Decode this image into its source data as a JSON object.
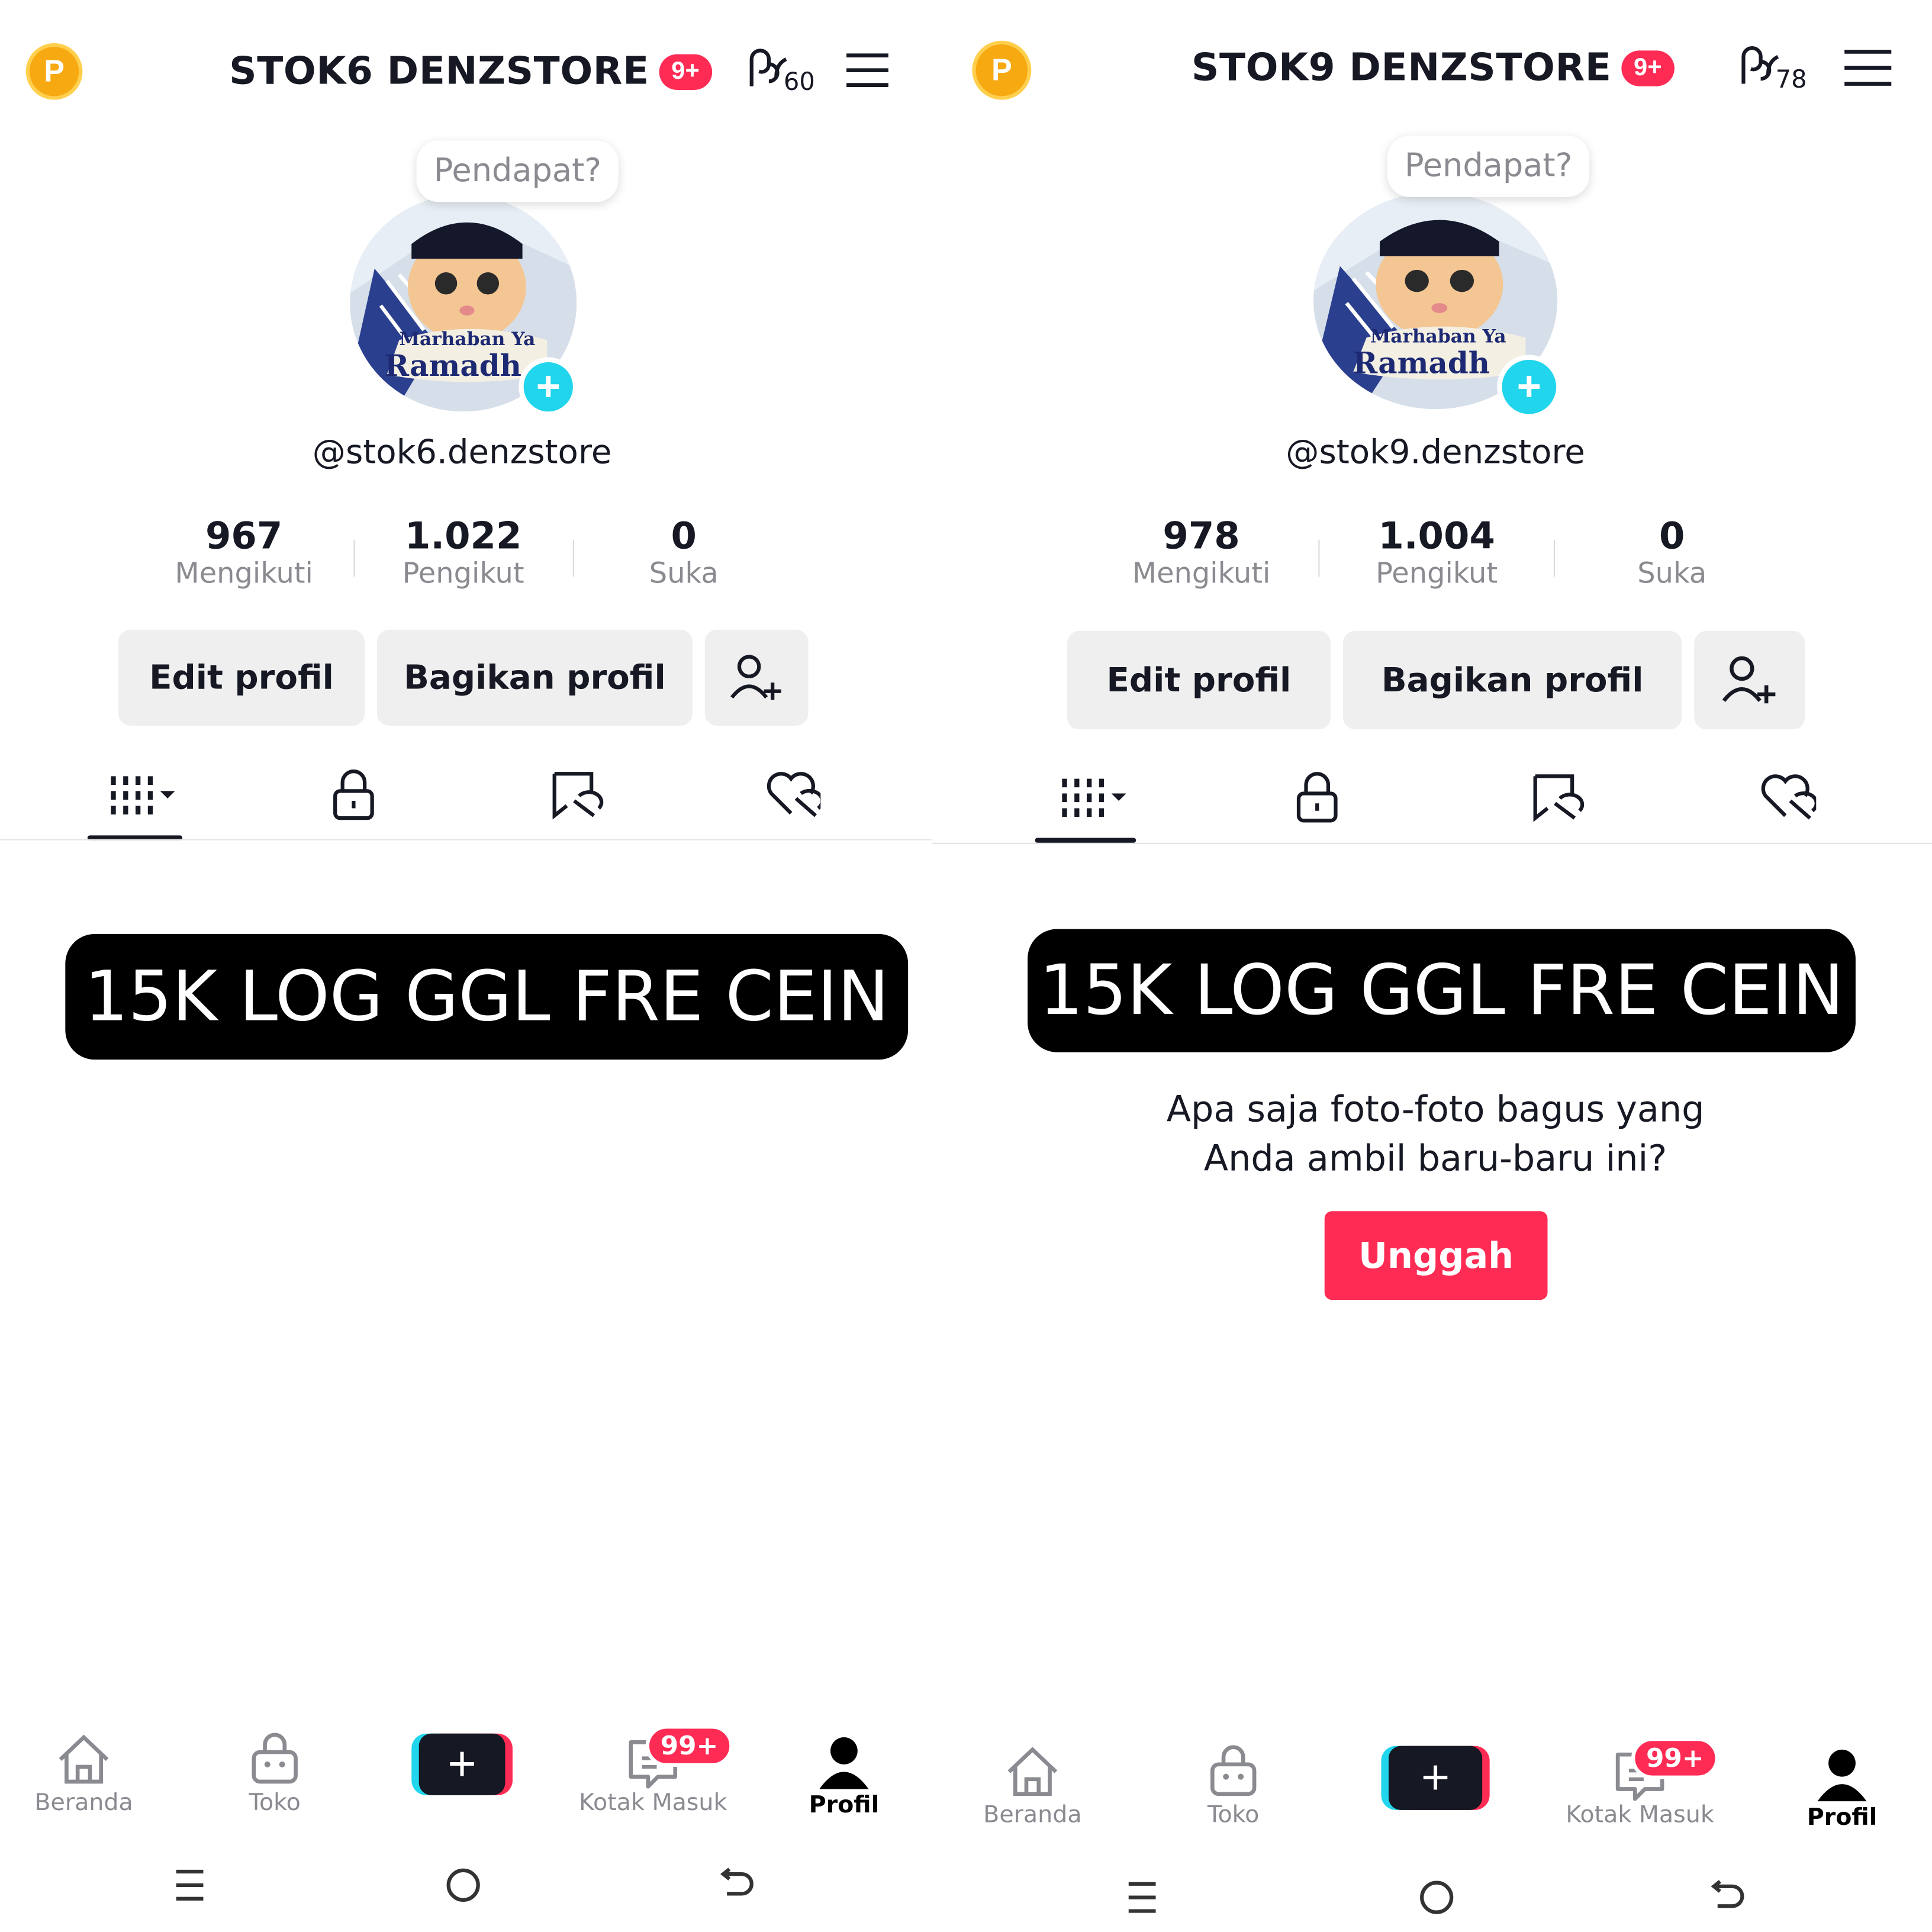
{
  "panels": [
    {
      "header": {
        "coin_label": "P",
        "title": "STOK6 DENZSTORE",
        "notif_badge": "9+",
        "creator_count": "60"
      },
      "bubble": "Pendapat?",
      "avatar": {
        "line1": "Marhaban Ya",
        "line2": "Ramadh"
      },
      "username": "@stok6.denzstore",
      "stats": [
        {
          "value": "967",
          "label": "Mengikuti"
        },
        {
          "value": "1.022",
          "label": "Pengikut"
        },
        {
          "value": "0",
          "label": "Suka"
        }
      ],
      "buttons": {
        "edit": "Edit profil",
        "share": "Bagikan profil"
      },
      "banner": "15K LOG GGL FRE CEIN",
      "nav": {
        "home": "Beranda",
        "shop": "Toko",
        "create": "+",
        "inbox": "Kotak Masuk",
        "inbox_badge": "99+",
        "profile": "Profil"
      }
    },
    {
      "header": {
        "coin_label": "P",
        "title": "STOK9 DENZSTORE",
        "notif_badge": "9+",
        "creator_count": "78"
      },
      "bubble": "Pendapat?",
      "avatar": {
        "line1": "Marhaban Ya",
        "line2": "Ramadh"
      },
      "username": "@stok9.denzstore",
      "stats": [
        {
          "value": "978",
          "label": "Mengikuti"
        },
        {
          "value": "1.004",
          "label": "Pengikut"
        },
        {
          "value": "0",
          "label": "Suka"
        }
      ],
      "buttons": {
        "edit": "Edit profil",
        "share": "Bagikan profil"
      },
      "banner": "15K LOG GGL FRE CEIN",
      "empty_state": {
        "line1": "Apa saja foto-foto bagus yang",
        "line2": "Anda ambil baru-baru ini?",
        "upload_button": "Unggah"
      },
      "nav": {
        "home": "Beranda",
        "shop": "Toko",
        "create": "+",
        "inbox": "Kotak Masuk",
        "inbox_badge": "99+",
        "profile": "Profil"
      }
    }
  ],
  "colors": {
    "accent_red": "#fe2c55",
    "accent_cyan": "#20d5ec",
    "coin": "#f7a912",
    "text_dark": "#161823",
    "text_grey": "#8a8b91"
  },
  "icons": [
    "coin-icon",
    "creator-tools-icon",
    "menu-icon",
    "add-friend-icon",
    "videos-grid-icon",
    "lock-icon",
    "reposts-icon",
    "liked-hidden-icon",
    "home-icon",
    "shop-icon",
    "inbox-icon",
    "profile-icon",
    "system-recents-icon",
    "system-home-icon",
    "system-back-icon"
  ]
}
